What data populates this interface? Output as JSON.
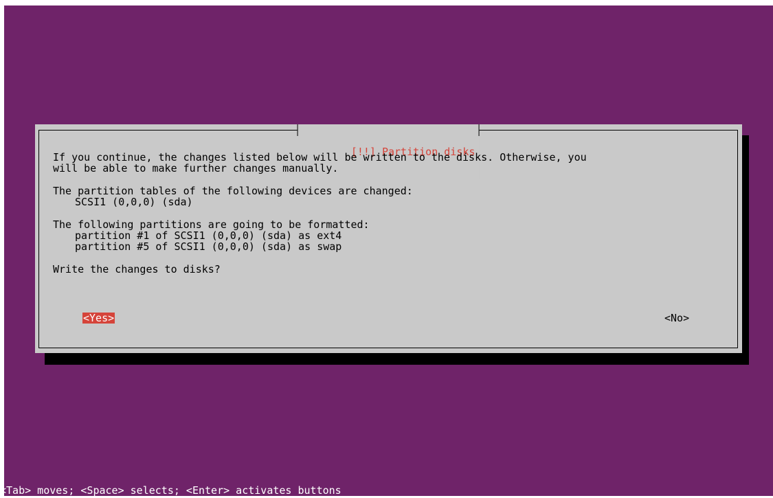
{
  "dialog": {
    "title": "[!!] Partition disks",
    "intro_line1": "If you continue, the changes listed below will be written to the disks. Otherwise, you",
    "intro_line2": "will be able to make further changes manually.",
    "tables_heading": "The partition tables of the following devices are changed:",
    "tables_devices": [
      "SCSI1 (0,0,0) (sda)"
    ],
    "format_heading": "The following partitions are going to be formatted:",
    "format_partitions": [
      "partition #1 of SCSI1 (0,0,0) (sda) as ext4",
      "partition #5 of SCSI1 (0,0,0) (sda) as swap"
    ],
    "question": "Write the changes to disks?",
    "yes_label": "<Yes>",
    "no_label": "<No>"
  },
  "status_bar": {
    "help_text": "<Tab> moves; <Space> selects; <Enter> activates buttons"
  },
  "colors": {
    "background": "#6f2369",
    "dialog": "#c9c9c9",
    "accent": "#d5443a"
  }
}
